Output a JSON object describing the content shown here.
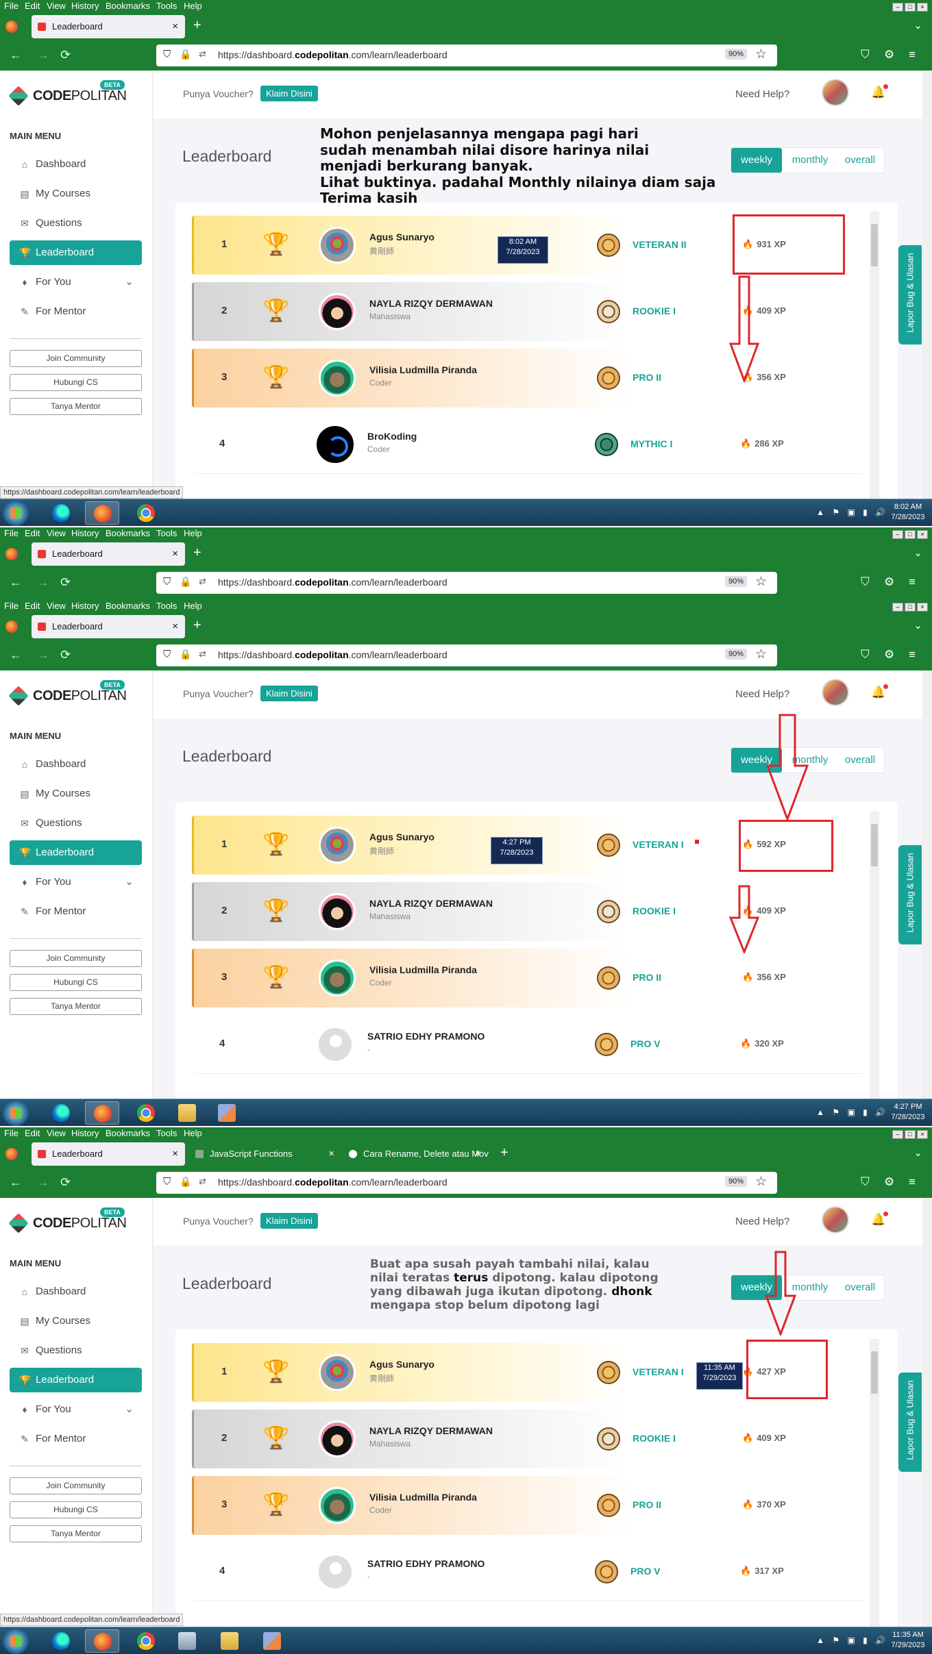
{
  "menu": [
    "File",
    "Edit",
    "View",
    "History",
    "Bookmarks",
    "Tools",
    "Help"
  ],
  "win_buttons": [
    "–",
    "□",
    "×"
  ],
  "browser": {
    "active_tab": "Leaderboard",
    "tab_js": "JavaScript Functions",
    "tab_cara": "Cara Rename, Delete atau Mov",
    "url_host_pre": "https://dashboard.",
    "url_host_bold": "codepolitan",
    "url_path": ".com/learn/leaderboard",
    "zoom": "90%",
    "close_glyph": "×",
    "new_tab_glyph": "+",
    "tab_list_glyph": "⌄"
  },
  "nav_icons": {
    "back": "←",
    "forward": "→",
    "reload": "⟳",
    "shield": "⛉",
    "lock": "🔒",
    "perm": "⇄",
    "star": "☆",
    "pocket": "⛉",
    "ext": "⚙",
    "menu": "≡"
  },
  "sidebar": {
    "logo_code": "CODE",
    "logo_politan": "POLITAN",
    "beta": "BETA",
    "main_menu": "MAIN MENU",
    "items": [
      {
        "label": "Dashboard",
        "icon": "⌂"
      },
      {
        "label": "My Courses",
        "icon": "▤"
      },
      {
        "label": "Questions",
        "icon": "✉"
      },
      {
        "label": "Leaderboard",
        "icon": "🏆"
      },
      {
        "label": "For You",
        "icon": "♦"
      },
      {
        "label": "For Mentor",
        "icon": "✎"
      }
    ],
    "chevron": "⌄",
    "buttons": [
      "Join Community",
      "Hubungi CS",
      "Tanya Mentor"
    ]
  },
  "topbar": {
    "voucher": "Punya Voucher?",
    "klaim": "Klaim Disini",
    "need_help": "Need Help?",
    "bell": "🔔"
  },
  "leaderboard": {
    "title": "Leaderboard",
    "toggles": [
      "weekly",
      "monthly",
      "overall"
    ],
    "lapor": "Lapor Bug & Ulasan",
    "trophy": "🏆",
    "xp_icon": "🔥"
  },
  "shots": [
    {
      "rows": [
        {
          "rank": "1",
          "name": "Agus Sunaryo",
          "role": "黄剛師",
          "tier": "VETERAN II",
          "xp": "931 XP"
        },
        {
          "rank": "2",
          "name": "NAYLA RIZQY DERMAWAN",
          "role": "Mahasiswa",
          "tier": "ROOKIE I",
          "xp": "409 XP"
        },
        {
          "rank": "3",
          "name": "Vilisia Ludmilla Piranda",
          "role": "Coder",
          "tier": "PRO II",
          "xp": "356 XP"
        },
        {
          "rank": "4",
          "name": "BroKoding",
          "role": "Coder",
          "tier": "MYTHIC I",
          "xp": "286 XP"
        }
      ],
      "stamp": {
        "time": "8:02 AM",
        "date": "7/28/2023"
      },
      "clock": {
        "time": "8:02 AM",
        "date": "7/28/2023"
      }
    },
    {
      "rows": [
        {
          "rank": "1",
          "name": "Agus Sunaryo",
          "role": "黄剛師",
          "tier": "VETERAN I",
          "xp": "592 XP"
        },
        {
          "rank": "2",
          "name": "NAYLA RIZQY DERMAWAN",
          "role": "Mahasiswa",
          "tier": "ROOKIE I",
          "xp": "409 XP"
        },
        {
          "rank": "3",
          "name": "Vilisia Ludmilla Piranda",
          "role": "Coder",
          "tier": "PRO II",
          "xp": "356 XP"
        },
        {
          "rank": "4",
          "name": "SATRIO EDHY PRAMONO",
          "role": "-",
          "tier": "PRO V",
          "xp": "320 XP"
        }
      ],
      "stamp": {
        "time": "4:27 PM",
        "date": "7/28/2023"
      },
      "clock": {
        "time": "4:27 PM",
        "date": "7/28/2023"
      }
    },
    {
      "rows": [
        {
          "rank": "1",
          "name": "Agus Sunaryo",
          "role": "黄剛師",
          "tier": "VETERAN I",
          "xp": "427 XP"
        },
        {
          "rank": "2",
          "name": "NAYLA RIZQY DERMAWAN",
          "role": "Mahasiswa",
          "tier": "ROOKIE I",
          "xp": "409 XP"
        },
        {
          "rank": "3",
          "name": "Vilisia Ludmilla Piranda",
          "role": "Coder",
          "tier": "PRO II",
          "xp": "370 XP"
        },
        {
          "rank": "4",
          "name": "SATRIO EDHY PRAMONO",
          "role": "-",
          "tier": "PRO V",
          "xp": "317 XP"
        }
      ],
      "stamp": {
        "time": "11:35 AM",
        "date": "7/29/2023"
      },
      "clock": {
        "time": "11:35 AM",
        "date": "7/29/2023"
      }
    }
  ],
  "status_url": "https://dashboard.codepolitan.com/learn/leaderboard",
  "tray": "▲ ⚑ ▣ ▮ 🔊",
  "annotations": {
    "note1": [
      "Mohon penjelasannya mengapa pagi hari",
      "sudah menambah nilai disore harinya nilai",
      "menjadi berkurang banyak.",
      "Lihat buktinya. padahal Monthly nilainya diam saja",
      "Terima kasih"
    ],
    "note2_l1": "Buat apa susah payah tambahi nilai, kalau",
    "note2_l2a": "nilai teratas ",
    "note2_l2b": "terus",
    "note2_l2c": " dipotong. kalau dipotong",
    "note2_l3a": "yang dibawah juga ikutan dipotong.",
    "note2_l3b": "dhonk",
    "note2_l4": "mengapa stop belum dipotong lagi"
  },
  "colors": {
    "firefox_green": "#1c7f32",
    "teal": "#17a398",
    "annotation_red": "#e0252b"
  }
}
